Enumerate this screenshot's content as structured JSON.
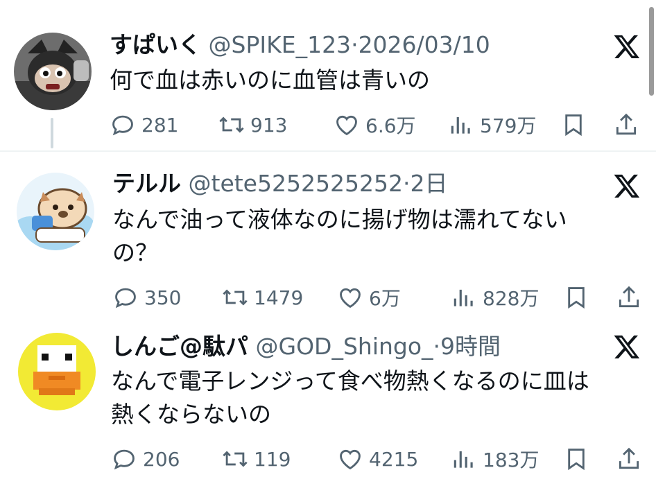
{
  "tweets": [
    {
      "name": "すぱいく",
      "handle": "@SPIKE_123",
      "dot": "·",
      "time": "2026/03/10",
      "text": "何で血は赤いのに血管は青いの",
      "replies": "281",
      "retweets": "913",
      "likes": "6.6万",
      "views": "579万"
    },
    {
      "name": "テルル",
      "handle": "@tete5252525252",
      "dot": "·",
      "time": "2日",
      "text": "なんで油って液体なのに揚げ物は濡れてない\nの？",
      "replies": "350",
      "retweets": "1479",
      "likes": "6万",
      "views": "828万"
    },
    {
      "name": "しんご@駄パ",
      "handle": "@GOD_Shingo_",
      "dot": "·",
      "time": "9時間",
      "text": "なんで電子レンジって食べ物熱くなるのに皿は\n熱くならないの",
      "replies": "206",
      "retweets": "119",
      "likes": "4215",
      "views": "183万"
    }
  ],
  "colors": {
    "text": "#0f1419",
    "secondary": "#536471",
    "divider": "#eff3f4"
  },
  "icons": [
    "reply-icon",
    "retweet-icon",
    "like-icon",
    "views-icon",
    "bookmark-icon",
    "share-icon",
    "x-logo-icon"
  ]
}
